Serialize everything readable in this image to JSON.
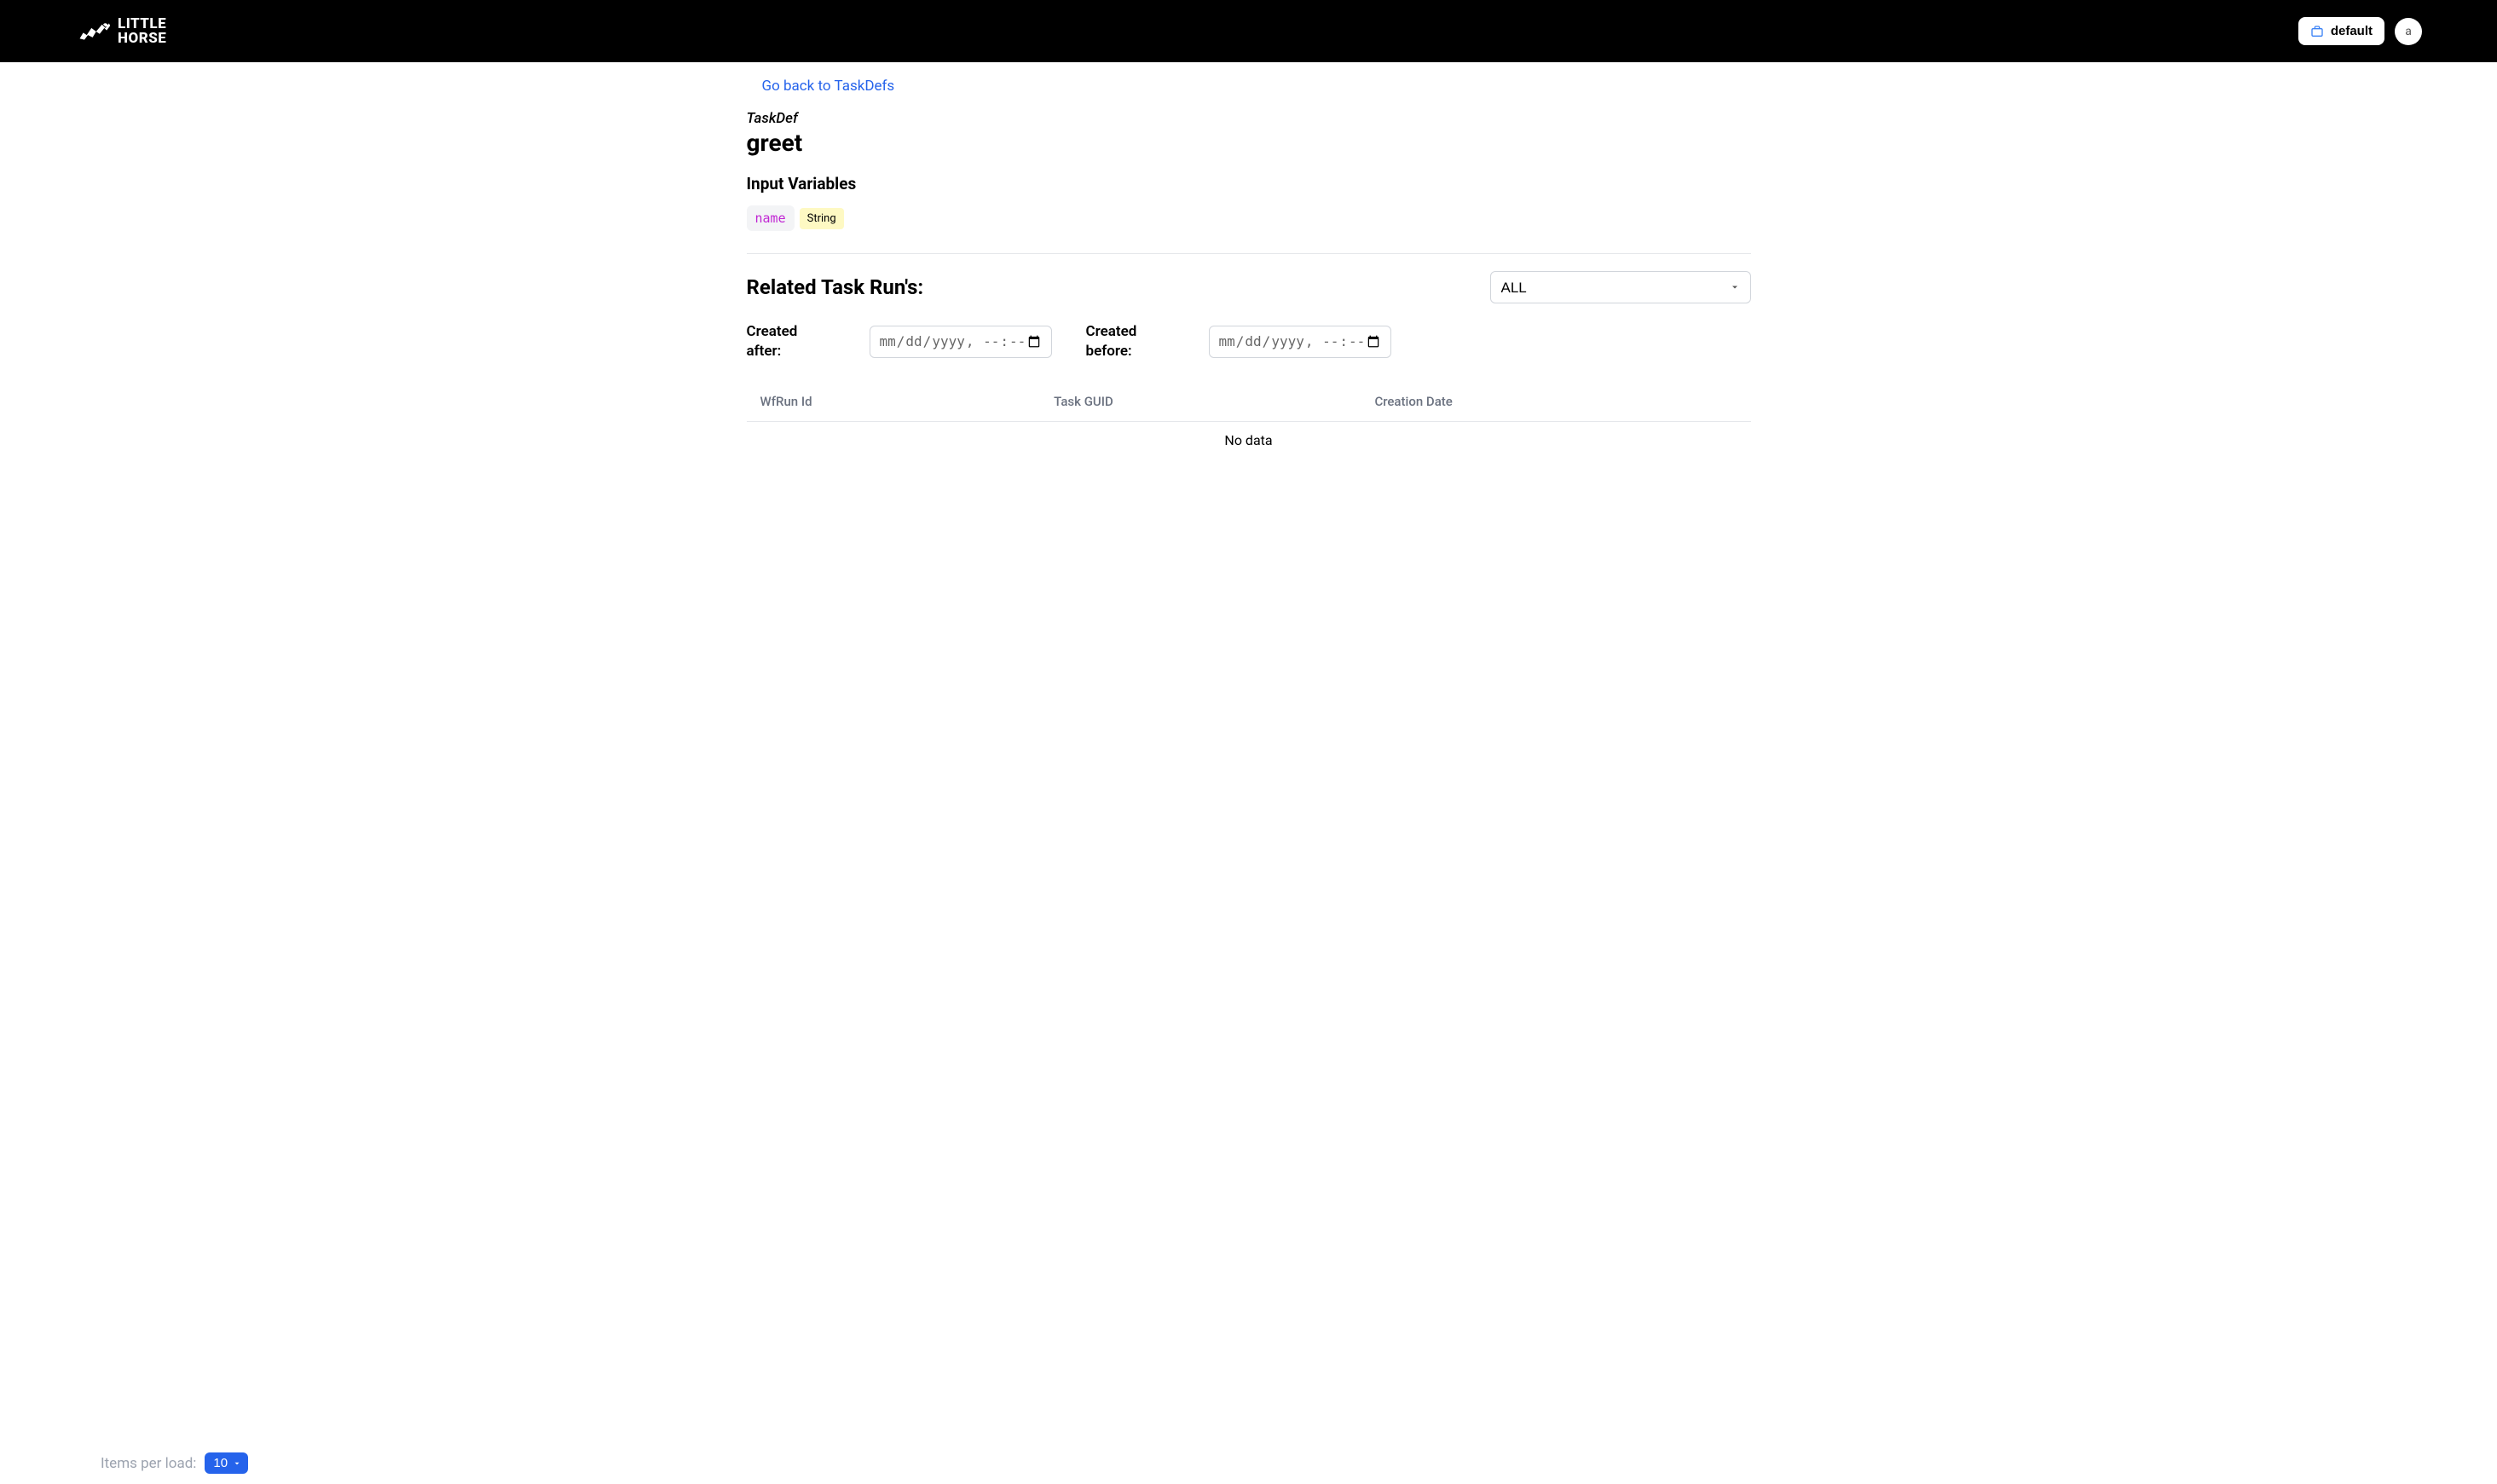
{
  "header": {
    "logo_line1": "LITTLE",
    "logo_line2": "HORSE",
    "tenant_label": "default",
    "avatar_initial": "a"
  },
  "nav": {
    "back_link": "Go back to TaskDefs"
  },
  "page": {
    "subtitle": "TaskDef",
    "title": "greet",
    "input_vars_heading": "Input Variables",
    "input_vars": [
      {
        "name": "name",
        "type": "String"
      }
    ]
  },
  "related": {
    "heading": "Related Task Run's:",
    "status_selected": "ALL",
    "status_options": [
      "ALL"
    ],
    "created_after_label": "Created after:",
    "created_before_label": "Created before:",
    "date_placeholder": "mm/dd/yyyy, --:--",
    "columns": [
      "WfRun Id",
      "Task GUID",
      "Creation Date"
    ],
    "no_data": "No data"
  },
  "footer": {
    "items_label": "Items per load:",
    "items_selected": "10",
    "items_options": [
      "10"
    ]
  }
}
